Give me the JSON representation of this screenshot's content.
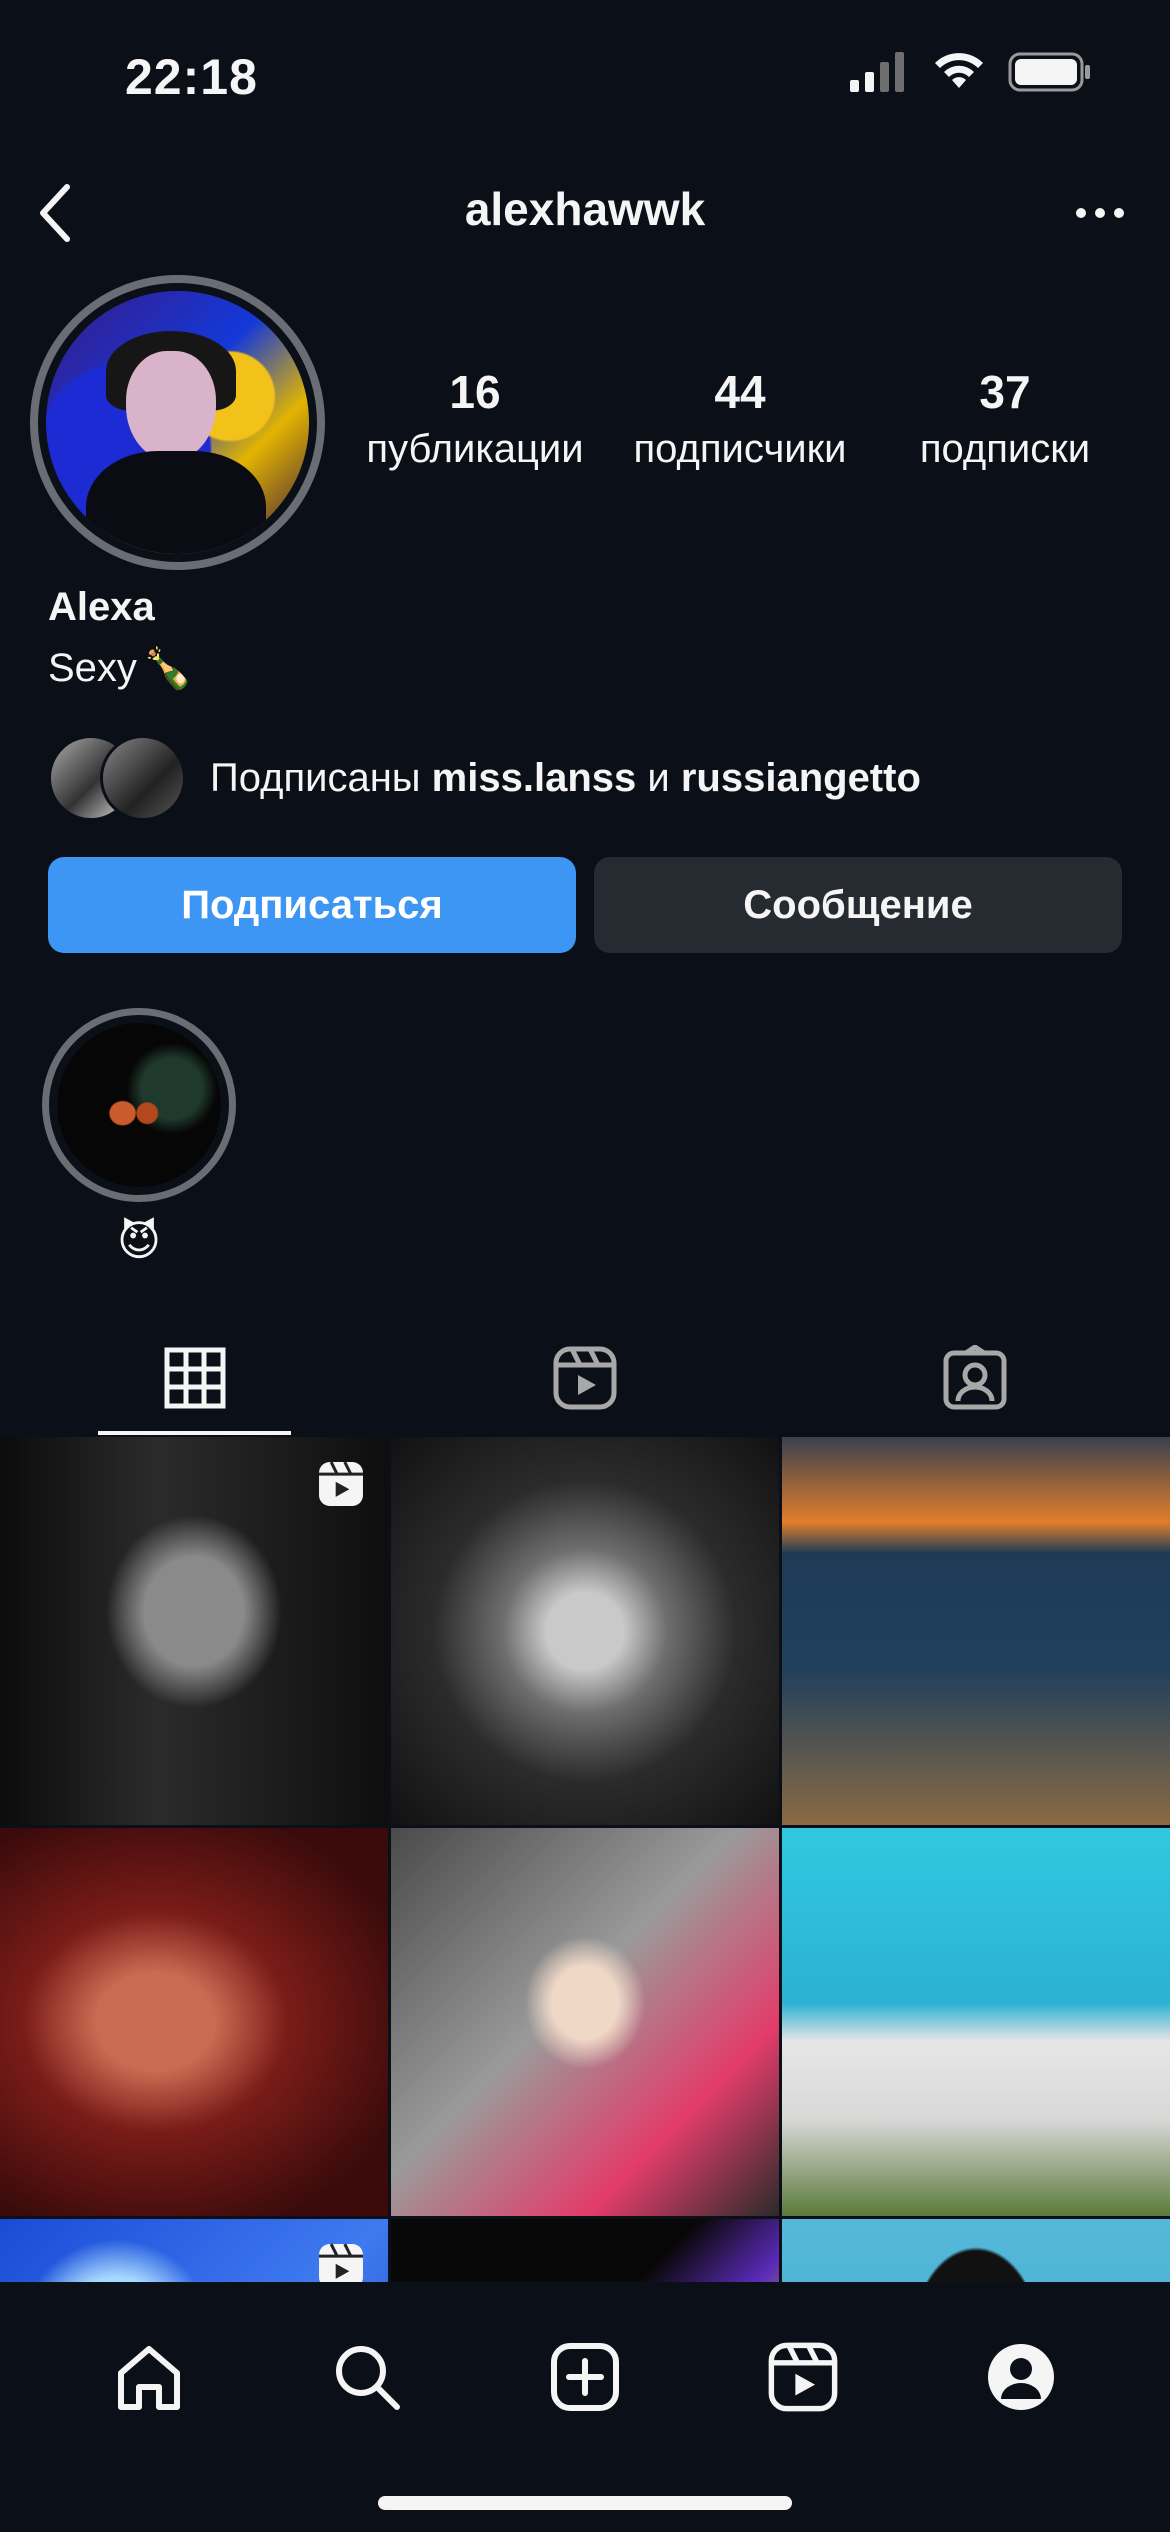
{
  "status_bar": {
    "time": "22:18"
  },
  "header": {
    "username": "alexhawwk"
  },
  "profile": {
    "stats": [
      {
        "count": "16",
        "label": "публикации"
      },
      {
        "count": "44",
        "label": "подписчики"
      },
      {
        "count": "37",
        "label": "подписки"
      }
    ],
    "display_name": "Alexa",
    "bio": "Sexy",
    "bio_emoji": "🍾",
    "followed_by": {
      "prefix": "Подписаны",
      "user1": "miss.lanss",
      "conjunction": "и",
      "user2": "russiangetto"
    },
    "buttons": {
      "follow": "Подписаться",
      "message": "Сообщение"
    }
  },
  "highlights": [
    {
      "label": "😈"
    }
  ],
  "tabs": [
    {
      "icon": "grid-icon",
      "active": true
    },
    {
      "icon": "reels-icon",
      "active": false
    },
    {
      "icon": "tagged-icon",
      "active": false
    }
  ],
  "posts": [
    {
      "id": "p1",
      "type": "reel"
    },
    {
      "id": "p2",
      "type": "photo"
    },
    {
      "id": "p3",
      "type": "photo"
    },
    {
      "id": "p4",
      "type": "photo"
    },
    {
      "id": "p5",
      "type": "photo"
    },
    {
      "id": "p6",
      "type": "photo"
    },
    {
      "id": "p7",
      "type": "reel"
    },
    {
      "id": "p8",
      "type": "photo"
    },
    {
      "id": "p9",
      "type": "photo"
    }
  ],
  "bottom_nav": [
    "home-icon",
    "search-icon",
    "create-icon",
    "reels-icon",
    "profile-icon"
  ],
  "colors": {
    "background": "#0b0f17",
    "follow_button": "#3d96f3",
    "message_button": "#262a31"
  }
}
